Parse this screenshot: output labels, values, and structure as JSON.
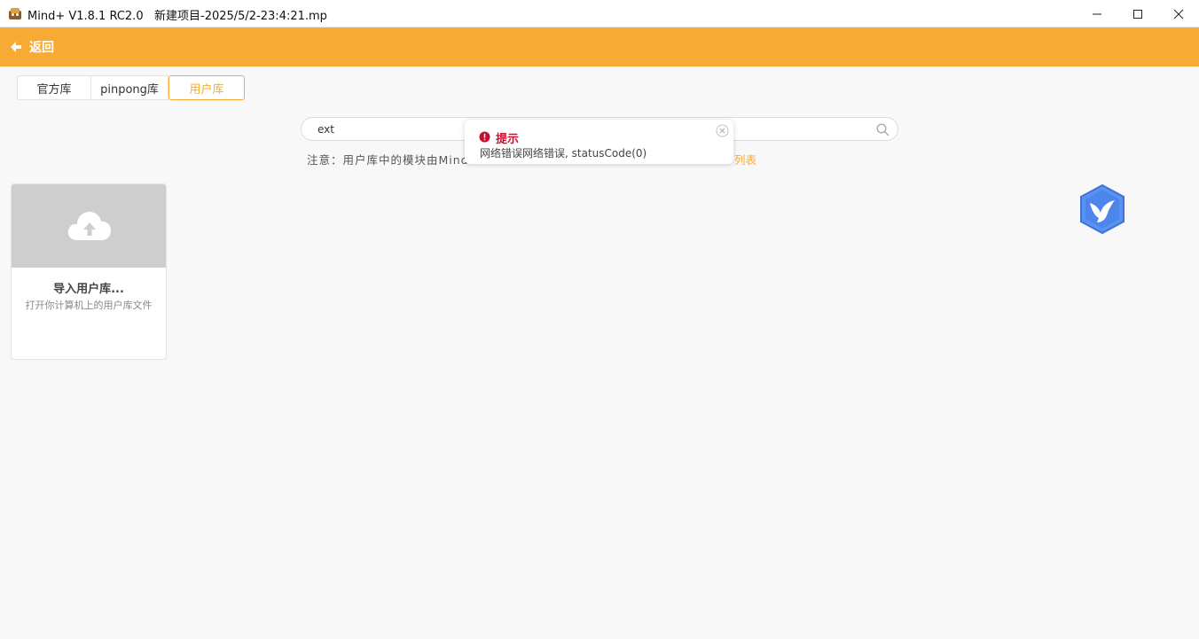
{
  "titlebar": {
    "app_name": "Mind+ V1.8.1 RC2.0",
    "project": "新建项目-2025/5/2-23:4:21.mp"
  },
  "header": {
    "back_label": "返回"
  },
  "tabs": [
    {
      "label": "官方库",
      "active": false
    },
    {
      "label": "pinpong库",
      "active": false
    },
    {
      "label": "用户库",
      "active": true
    }
  ],
  "search": {
    "value": "ext"
  },
  "note": {
    "text": "注意：用户库中的模块由Mind",
    "link": "列表"
  },
  "toast": {
    "title": "提示",
    "message": "网络错误网络错误, statusCode(0)"
  },
  "card": {
    "title": "导入用户库...",
    "subtitle": "打开你计算机上的用户库文件"
  },
  "colors": {
    "accent": "#f8ab34",
    "error": "#c8102e"
  }
}
